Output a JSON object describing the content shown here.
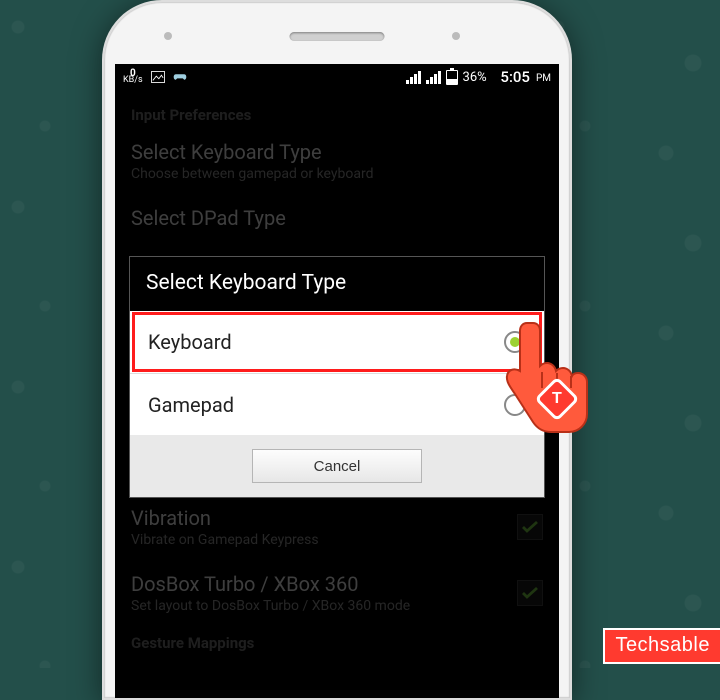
{
  "status": {
    "kbs_value": "0",
    "kbs_unit": "KB/s",
    "battery_pct": "36%",
    "time": "5:05",
    "time_period": "PM"
  },
  "prefs": {
    "section_header": "Input Preferences",
    "keyboard_type_title": "Select Keyboard Type",
    "keyboard_type_sub": "Choose between gamepad or keyboard",
    "dpad_type_title": "Select DPad Type",
    "vibration_title": "Vibration",
    "vibration_sub": "Vibrate on Gamepad Keypress",
    "dosbox_title": "DosBox Turbo / XBox 360",
    "dosbox_sub": "Set layout to DosBox Turbo / XBox 360 mode",
    "gesture_header": "Gesture Mappings"
  },
  "dialog": {
    "title": "Select Keyboard Type",
    "options": [
      {
        "label": "Keyboard",
        "selected": true
      },
      {
        "label": "Gamepad",
        "selected": false
      }
    ],
    "cancel": "Cancel"
  },
  "pointer_badge": "T",
  "watermark": "Techsable"
}
